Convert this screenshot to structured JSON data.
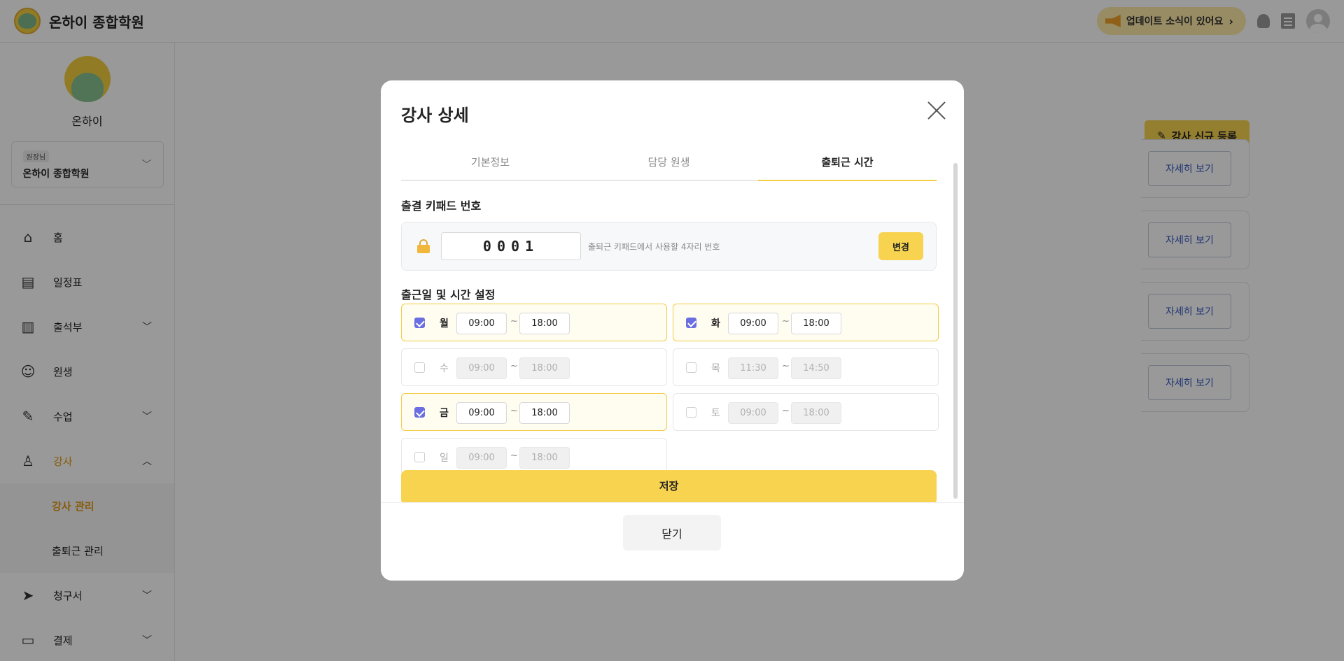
{
  "header": {
    "brand_name": "온하이 종합학원",
    "update_text": "업데이트 소식이 있어요",
    "update_chevron": "›"
  },
  "sidebar": {
    "profile_name": "온하이",
    "role_badge": "원장님",
    "academy_name": "온하이 종합학원",
    "items": [
      {
        "label": "홈",
        "icon": "home-icon"
      },
      {
        "label": "일정표",
        "icon": "calendar-icon"
      },
      {
        "label": "출석부",
        "icon": "book-icon"
      },
      {
        "label": "원생",
        "icon": "smile-icon"
      },
      {
        "label": "수업",
        "icon": "pen-icon"
      },
      {
        "label": "강사",
        "icon": "person-icon"
      },
      {
        "label": "청구서",
        "icon": "send-icon"
      },
      {
        "label": "결제",
        "icon": "card-icon"
      }
    ],
    "sub_items": [
      {
        "label": "강사 관리"
      },
      {
        "label": "출퇴근 관리"
      }
    ]
  },
  "main": {
    "new_button_label": "강사 신규 등록",
    "detail_button_label": "자세히 보기"
  },
  "modal": {
    "title": "강사 상세",
    "tabs": [
      "기본정보",
      "담당 원생",
      "출퇴근 시간"
    ],
    "keypad_section_title": "출결 키패드 번호",
    "keypad_number": "0001",
    "keypad_hint": "출퇴근 키패드에서 사용할 4자리 번호",
    "change_button": "변경",
    "schedule_section_title": "출근일 및 시간 설정",
    "days": [
      {
        "label": "월",
        "start": "09:00",
        "end": "18:00",
        "checked": true
      },
      {
        "label": "화",
        "start": "09:00",
        "end": "18:00",
        "checked": true
      },
      {
        "label": "수",
        "start": "09:00",
        "end": "18:00",
        "checked": false
      },
      {
        "label": "목",
        "start": "11:30",
        "end": "14:50",
        "checked": false
      },
      {
        "label": "금",
        "start": "09:00",
        "end": "18:00",
        "checked": true
      },
      {
        "label": "토",
        "start": "09:00",
        "end": "18:00",
        "checked": false
      },
      {
        "label": "일",
        "start": "09:00",
        "end": "18:00",
        "checked": false
      }
    ],
    "tilde": "~",
    "save_button": "저장",
    "close_button": "닫기"
  },
  "colors": {
    "accent": "#f7d34f",
    "active_menu": "#e39a12",
    "checkbox": "#6a6ee0",
    "link": "#3659c2"
  }
}
